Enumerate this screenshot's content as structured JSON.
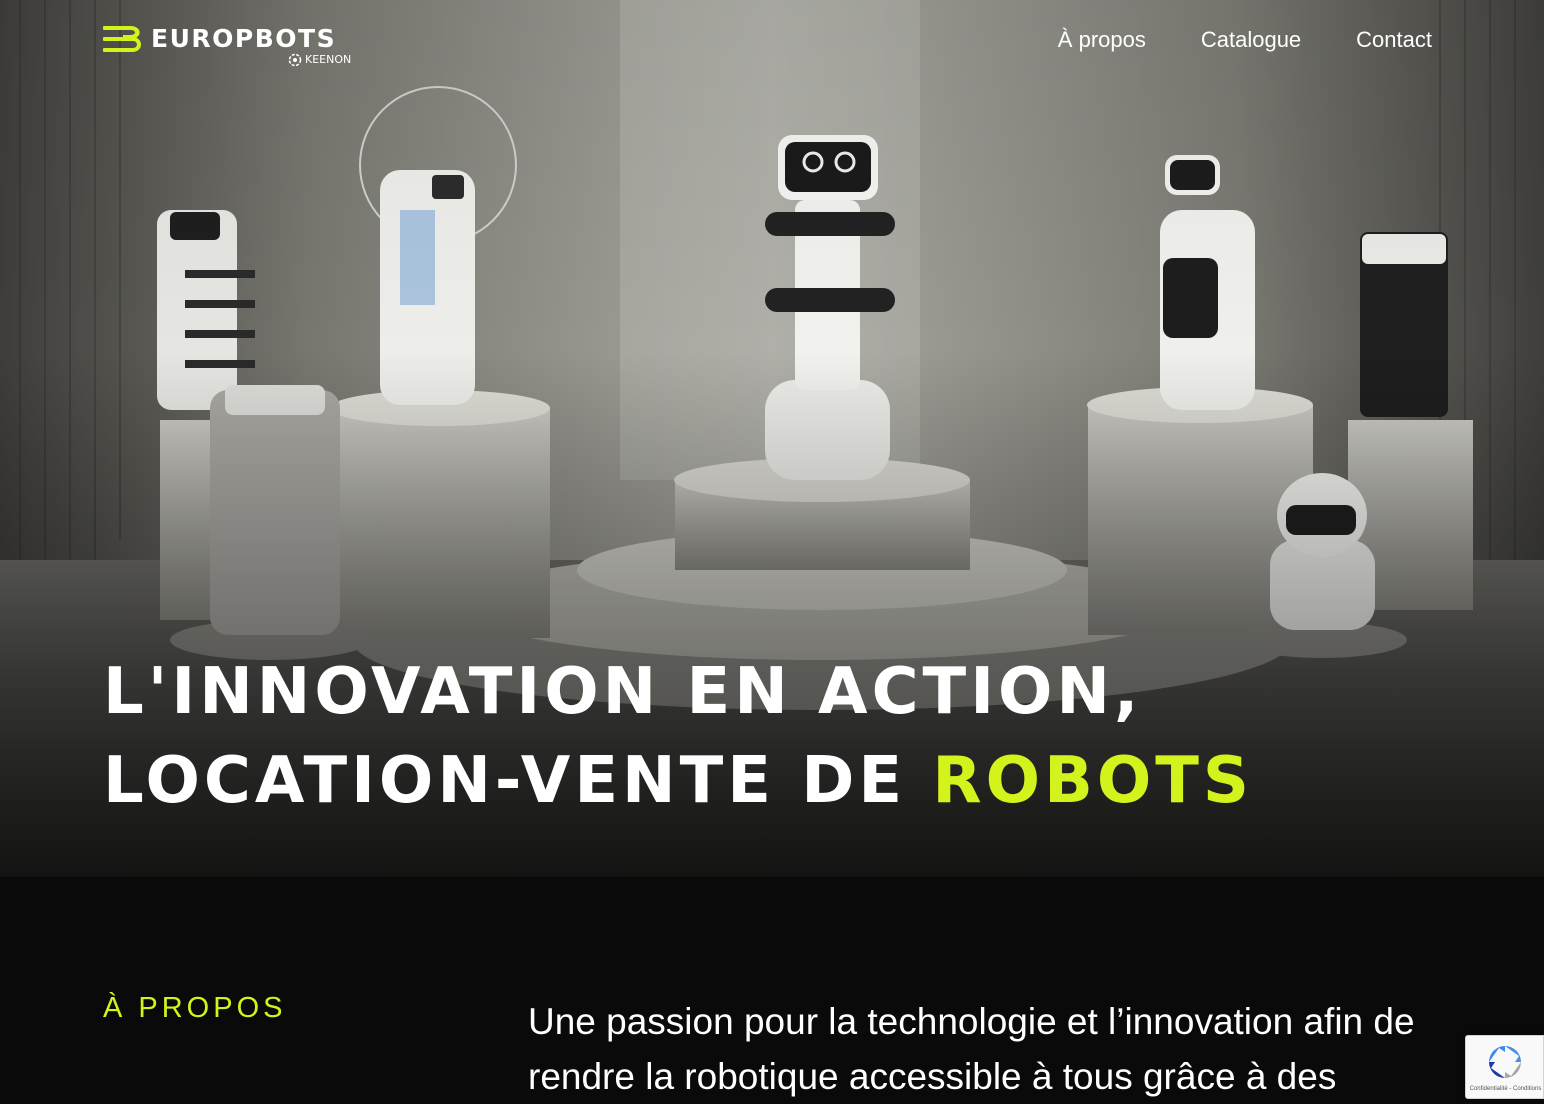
{
  "header": {
    "logo_text": "EUROPBOTS",
    "logo_subtext": "KEENON",
    "nav": [
      {
        "label": "À propos"
      },
      {
        "label": "Catalogue"
      },
      {
        "label": "Contact"
      }
    ]
  },
  "hero": {
    "headline_line1": "L'INNOVATION EN ACTION,",
    "headline_line2_prefix": "LOCATION-VENTE DE ",
    "headline_line2_accent": "ROBOTS",
    "image_icon": "robots-showroom-image"
  },
  "about": {
    "label": "À PROPOS",
    "text": "Une passion pour la technologie et l’innovation afin de rendre la robotique accessible à tous grâce à des"
  },
  "recaptcha": {
    "links": "Confidentialité - Conditions"
  },
  "colors": {
    "accent": "#d4f21c",
    "background": "#0a0a0a",
    "text": "#ffffff"
  }
}
